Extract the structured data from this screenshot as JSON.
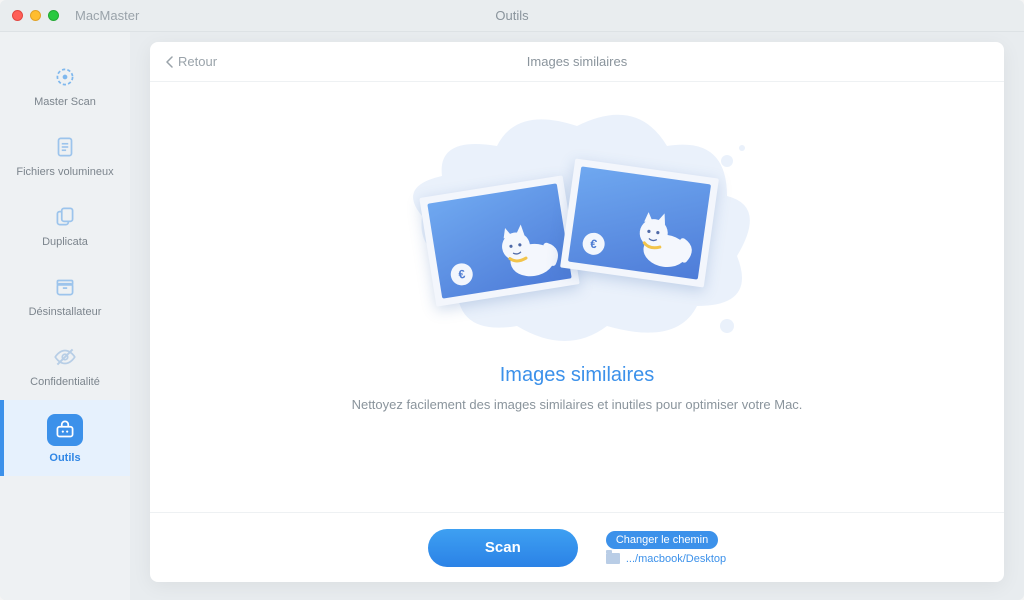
{
  "titlebar": {
    "app_name": "MacMaster",
    "center_title": "Outils"
  },
  "sidebar": {
    "items": [
      {
        "id": "master-scan",
        "label": "Master Scan"
      },
      {
        "id": "large-files",
        "label": "Fichiers volumineux"
      },
      {
        "id": "duplicates",
        "label": "Duplicata"
      },
      {
        "id": "uninstaller",
        "label": "Désinstallateur"
      },
      {
        "id": "privacy",
        "label": "Confidentialité"
      },
      {
        "id": "tools",
        "label": "Outils"
      }
    ]
  },
  "card": {
    "back_label": "Retour",
    "header_title": "Images similaires",
    "headline": "Images similaires",
    "description": "Nettoyez facilement des images similaires et inutiles pour optimiser votre Mac.",
    "scan_button": "Scan",
    "change_path_label": "Changer le chemin",
    "path_display": ".../macbook/Desktop"
  },
  "colors": {
    "accent": "#3c91ea"
  }
}
